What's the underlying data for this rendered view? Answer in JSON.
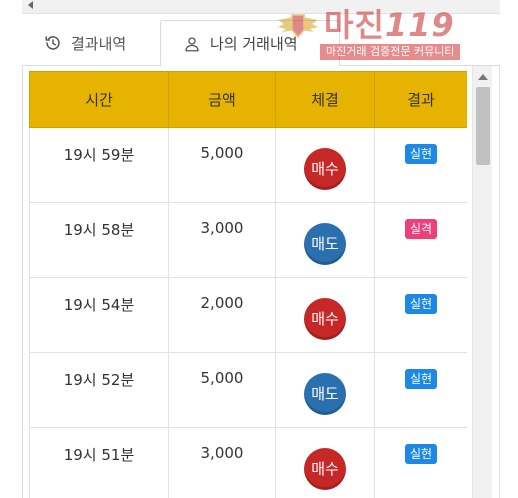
{
  "watermark": {
    "brand_text": "마진",
    "brand_num": "119",
    "tagline": "마진거래 검증전문 커뮤니티"
  },
  "tabs": [
    {
      "label": "결과내역",
      "icon": "history-icon",
      "active": false
    },
    {
      "label": "나의 거래내역",
      "icon": "user-icon",
      "active": true
    }
  ],
  "table": {
    "headers": [
      "시간",
      "금액",
      "체결",
      "결과"
    ],
    "rows": [
      {
        "time": "19시 59분",
        "amount": "5,000",
        "side": "매수",
        "result": "실현"
      },
      {
        "time": "19시 58분",
        "amount": "3,000",
        "side": "매도",
        "result": "실격"
      },
      {
        "time": "19시 54분",
        "amount": "2,000",
        "side": "매수",
        "result": "실현"
      },
      {
        "time": "19시 52분",
        "amount": "5,000",
        "side": "매도",
        "result": "실현"
      },
      {
        "time": "19시 51분",
        "amount": "3,000",
        "side": "매수",
        "result": "실현"
      }
    ]
  },
  "colors": {
    "header_bg": "#e6b300",
    "buy": "#c62828",
    "sell": "#2a6fae",
    "realized": "#1e88e5",
    "disqualified": "#ec407a"
  }
}
